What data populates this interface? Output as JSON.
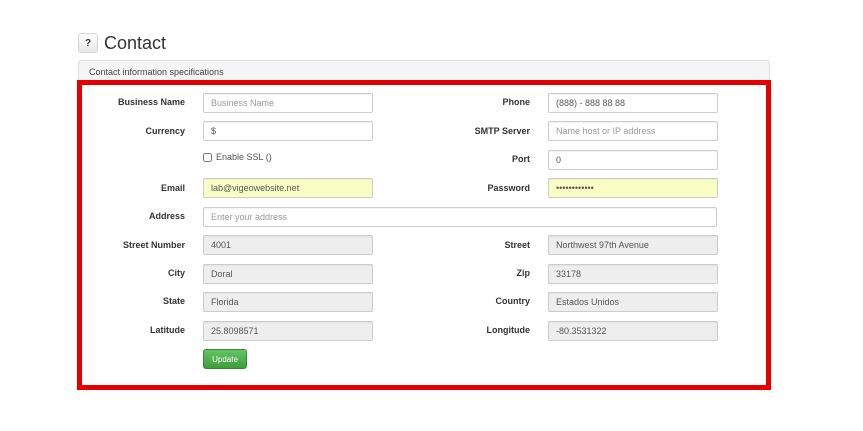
{
  "header": {
    "help_label": "?",
    "title": "Contact",
    "panel_heading": "Contact information specifications"
  },
  "form": {
    "business_name": {
      "label": "Business Name",
      "value": "",
      "placeholder": "Business Name"
    },
    "phone": {
      "label": "Phone",
      "value": "(888) - 888 88 88",
      "placeholder": ""
    },
    "currency": {
      "label": "Currency",
      "value": "$",
      "placeholder": ""
    },
    "smtp_server": {
      "label": "SMTP Server",
      "value": "",
      "placeholder": "Name host or IP address"
    },
    "enable_ssl": {
      "label": "Enable SSL ()",
      "checked": false
    },
    "port": {
      "label": "Port",
      "value": "0",
      "placeholder": ""
    },
    "email": {
      "label": "Email",
      "value": "lab@vigeowebsite.net",
      "placeholder": ""
    },
    "password": {
      "label": "Password",
      "value": "••••••••••••",
      "placeholder": ""
    },
    "address": {
      "label": "Address",
      "value": "",
      "placeholder": "Enter your address"
    },
    "street_number": {
      "label": "Street Number",
      "value": "4001"
    },
    "street": {
      "label": "Street",
      "value": "Northwest 97th Avenue"
    },
    "city": {
      "label": "City",
      "value": "Doral"
    },
    "zip": {
      "label": "Zip",
      "value": "33178"
    },
    "state": {
      "label": "State",
      "value": "Florida"
    },
    "country": {
      "label": "Country",
      "value": "Estados Unidos"
    },
    "latitude": {
      "label": "Latitude",
      "value": "25.8098571"
    },
    "longitude": {
      "label": "Longitude",
      "value": "-80.3531322"
    },
    "update_label": "Update"
  },
  "colors": {
    "highlight_frame": "#e60000",
    "autofill_bg": "#fafdc4",
    "readonly_bg": "#eeeeee",
    "primary_button": "#4cae4c"
  }
}
